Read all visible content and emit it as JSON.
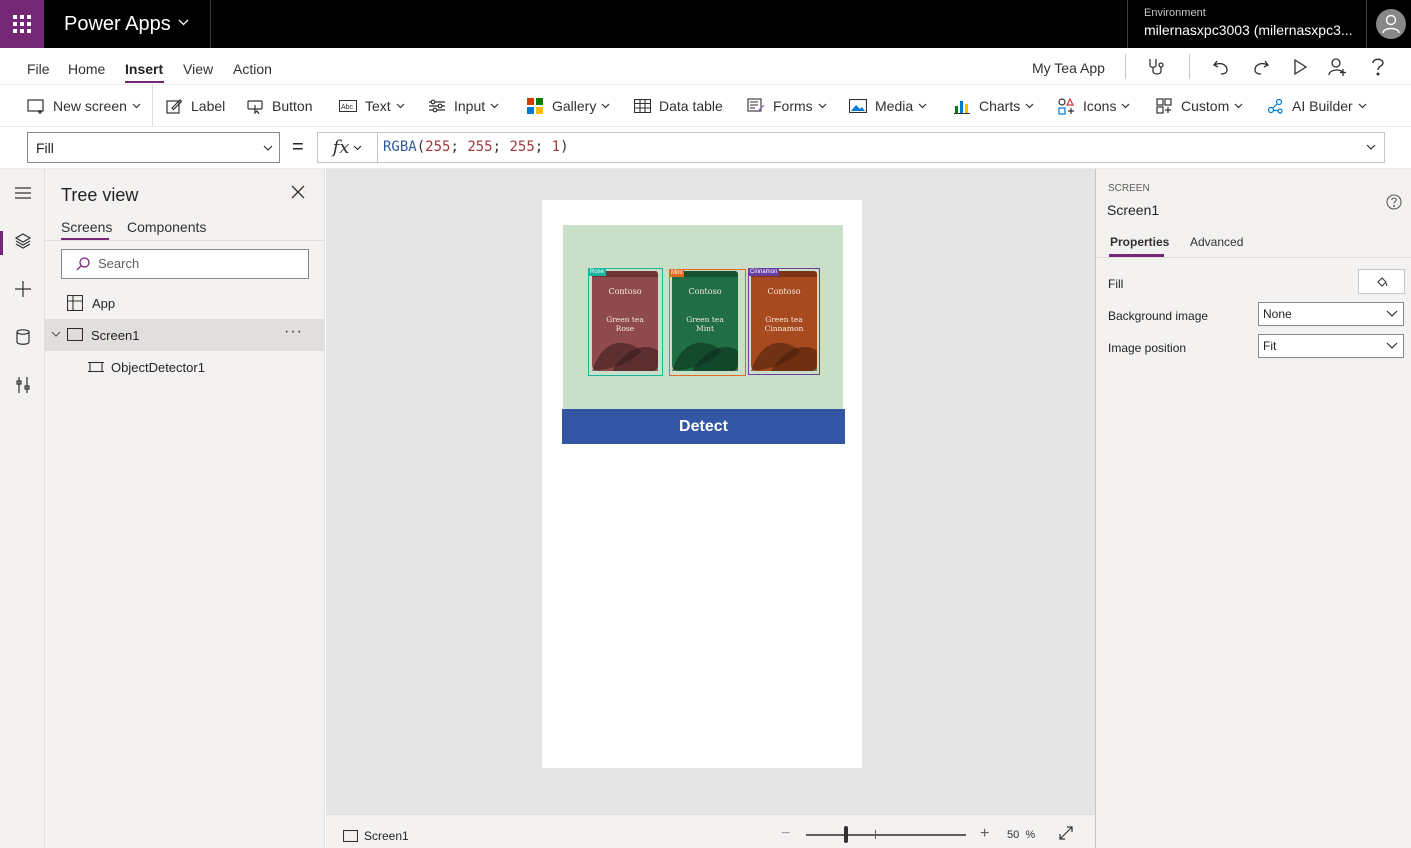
{
  "topbar": {
    "app_name": "Power Apps",
    "environment_label": "Environment",
    "environment_value": "milernasxpc3003 (milernasxpc3..."
  },
  "menu": {
    "items": [
      "File",
      "Home",
      "Insert",
      "View",
      "Action"
    ],
    "active": "Insert",
    "app_title": "My Tea App"
  },
  "ribbon": {
    "new_screen": "New screen",
    "label": "Label",
    "button": "Button",
    "text": "Text",
    "input": "Input",
    "gallery": "Gallery",
    "data_table": "Data table",
    "forms": "Forms",
    "media": "Media",
    "charts": "Charts",
    "icons": "Icons",
    "custom": "Custom",
    "ai_builder": "AI Builder"
  },
  "formula_bar": {
    "property": "Fill",
    "equals": "=",
    "fx": "fx",
    "func": "RGBA",
    "open_paren": "(",
    "args": [
      "255",
      "255",
      "255",
      "1"
    ],
    "separator": ";",
    "close_paren": ")"
  },
  "tree_view": {
    "title": "Tree view",
    "tabs": [
      "Screens",
      "Components"
    ],
    "search_placeholder": "Search",
    "items": [
      {
        "label": "App"
      },
      {
        "label": "Screen1"
      },
      {
        "label": "ObjectDetector1"
      }
    ],
    "more": "···"
  },
  "canvas": {
    "cans": [
      {
        "brand": "Contoso",
        "flavor_line1": "Green tea",
        "flavor_line2": "Rose",
        "tag": "Rose",
        "color": "#8e4a4c",
        "tag_color": "#19b5a0"
      },
      {
        "brand": "Contoso",
        "flavor_line1": "Green tea",
        "flavor_line2": "Mint",
        "tag": "Mint",
        "color": "#1f6e44",
        "tag_color": "#e36a1e"
      },
      {
        "brand": "Contoso",
        "flavor_line1": "Green tea",
        "flavor_line2": "Cinnamon",
        "tag": "Cinnamon",
        "color": "#a84a1f",
        "tag_color": "#6b3fa0"
      }
    ],
    "detect_label": "Detect"
  },
  "status_bar": {
    "screen_name": "Screen1",
    "zoom_value": "50",
    "zoom_unit": "%"
  },
  "properties": {
    "kind": "SCREEN",
    "name": "Screen1",
    "tabs": [
      "Properties",
      "Advanced"
    ],
    "fill_label": "Fill",
    "background_image_label": "Background image",
    "background_image_value": "None",
    "image_position_label": "Image position",
    "image_position_value": "Fit"
  },
  "colors": {
    "brand_purple": "#742774",
    "detect_button": "#3255a4",
    "detector_bg": "#c9dfc7"
  }
}
